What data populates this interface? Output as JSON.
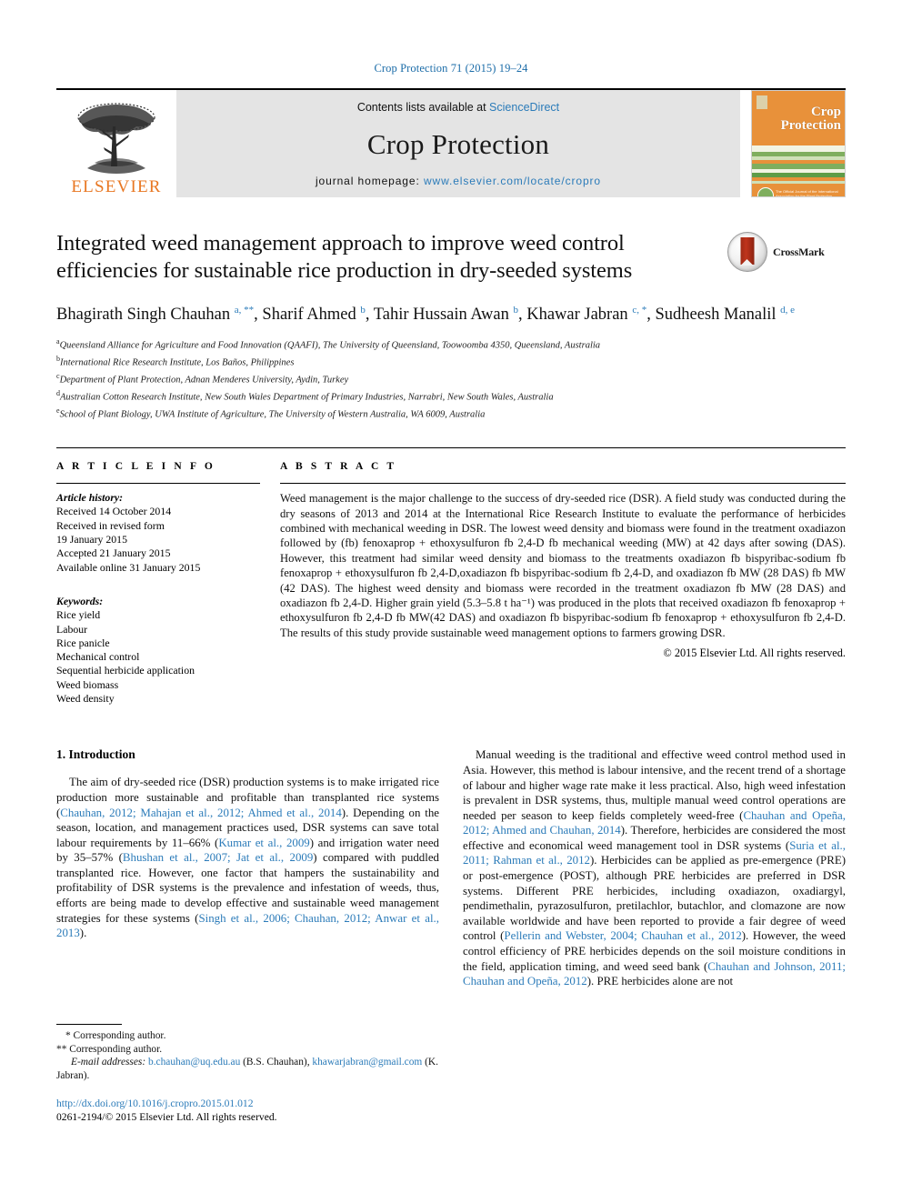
{
  "running_head": "Crop Protection 71 (2015) 19–24",
  "masthead": {
    "publisher_word": "ELSEVIER",
    "contents_prefix": "Contents lists available at ",
    "contents_link": "ScienceDirect",
    "journal_name": "Crop Protection",
    "homepage_prefix": "journal homepage: ",
    "homepage_url": "www.elsevier.com/locate/cropro",
    "cover_title_line1": "Crop",
    "cover_title_line2": "Protection",
    "cover_footer_text": "The Official Journal of the International Association for the Plant Protection Sciences"
  },
  "article": {
    "title": "Integrated weed management approach to improve weed control efficiencies for sustainable rice production in dry-seeded systems",
    "crossmark_label": "CrossMark",
    "authors_html": "Bhagirath Singh Chauhan <sup>a, **</sup>, Sharif Ahmed <sup>b</sup>, Tahir Hussain Awan <sup>b</sup>, Khawar Jabran <sup>c, *</sup>, Sudheesh Manalil <sup>d, e</sup>",
    "affiliations": [
      {
        "label": "a",
        "text": "Queensland Alliance for Agriculture and Food Innovation (QAAFI), The University of Queensland, Toowoomba 4350, Queensland, Australia"
      },
      {
        "label": "b",
        "text": "International Rice Research Institute, Los Baños, Philippines"
      },
      {
        "label": "c",
        "text": "Department of Plant Protection, Adnan Menderes University, Aydin, Turkey"
      },
      {
        "label": "d",
        "text": "Australian Cotton Research Institute, New South Wales Department of Primary Industries, Narrabri, New South Wales, Australia"
      },
      {
        "label": "e",
        "text": "School of Plant Biology, UWA Institute of Agriculture, The University of Western Australia, WA 6009, Australia"
      }
    ]
  },
  "article_info": {
    "heading": "A R T I C L E   I N F O",
    "history_label": "Article history:",
    "history_lines": [
      "Received 14 October 2014",
      "Received in revised form",
      "19 January 2015",
      "Accepted 21 January 2015",
      "Available online 31 January 2015"
    ],
    "keywords_label": "Keywords:",
    "keywords": [
      "Rice yield",
      "Labour",
      "Rice panicle",
      "Mechanical control",
      "Sequential herbicide application",
      "Weed biomass",
      "Weed density"
    ]
  },
  "abstract": {
    "heading": "A B S T R A C T",
    "text": "Weed management is the major challenge to the success of dry-seeded rice (DSR). A field study was conducted during the dry seasons of 2013 and 2014 at the International Rice Research Institute to evaluate the performance of herbicides combined with mechanical weeding in DSR. The lowest weed density and biomass were found in the treatment oxadiazon followed by (fb) fenoxaprop + ethoxysulfuron fb 2,4-D fb mechanical weeding (MW) at 42 days after sowing (DAS). However, this treatment had similar weed density and biomass to the treatments oxadiazon fb bispyribac-sodium fb fenoxaprop + ethoxysulfuron fb 2,4-D,oxadiazon fb bispyribac-sodium fb 2,4-D, and oxadiazon fb MW (28 DAS) fb MW (42 DAS). The highest weed density and biomass were recorded in the treatment oxadiazon fb MW (28 DAS) and oxadiazon fb 2,4-D. Higher grain yield (5.3–5.8 t ha⁻¹) was produced in the plots that received oxadiazon fb fenoxaprop + ethoxysulfuron fb 2,4-D fb MW(42 DAS) and oxadiazon fb bispyribac-sodium fb fenoxaprop + ethoxysulfuron fb 2,4-D. The results of this study provide sustainable weed management options to farmers growing DSR.",
    "copyright": "© 2015 Elsevier Ltd. All rights reserved."
  },
  "introduction": {
    "heading": "1. Introduction",
    "left_paragraph_html": "The aim of dry-seeded rice (DSR) production systems is to make irrigated rice production more sustainable and profitable than transplanted rice systems (<span class=\"ref\">Chauhan, 2012; Mahajan et al., 2012; Ahmed et al., 2014</span>). Depending on the season, location, and management practices used, DSR systems can save total labour requirements by 11–66% (<span class=\"ref\">Kumar et al., 2009</span>) and irrigation water need by 35–57% (<span class=\"ref\">Bhushan et al., 2007; Jat et al., 2009</span>) compared with puddled transplanted rice. However, one factor that hampers the sustainability and profitability of DSR systems is the prevalence and infestation of weeds, thus, efforts are being made to develop effective and sustainable weed management strategies for these systems (<span class=\"ref\">Singh et al., 2006; Chauhan, 2012; Anwar et al., 2013</span>).",
    "right_paragraph_html": "Manual weeding is the traditional and effective weed control method used in Asia. However, this method is labour intensive, and the recent trend of a shortage of labour and higher wage rate make it less practical. Also, high weed infestation is prevalent in DSR systems, thus, multiple manual weed control operations are needed per season to keep fields completely weed-free (<span class=\"ref\">Chauhan and Opeña, 2012; Ahmed and Chauhan, 2014</span>). Therefore, herbicides are considered the most effective and economical weed management tool in DSR systems (<span class=\"ref\">Suria et al., 2011; Rahman et al., 2012</span>). Herbicides can be applied as pre-emergence (PRE) or post-emergence (POST), although PRE herbicides are preferred in DSR systems. Different PRE herbicides, including oxadiazon, oxadiargyl, pendimethalin, pyrazosulfuron, pretilachlor, butachlor, and clomazone are now available worldwide and have been reported to provide a fair degree of weed control (<span class=\"ref\">Pellerin and Webster, 2004; Chauhan et al., 2012</span>). However, the weed control efficiency of PRE herbicides depends on the soil moisture conditions in the field, application timing, and weed seed bank (<span class=\"ref\">Chauhan and Johnson, 2011; Chauhan and Opeña, 2012</span>). PRE herbicides alone are not"
  },
  "footnotes": {
    "star_line": "* Corresponding author.",
    "doublestar_line": "** Corresponding author.",
    "email_label": "E-mail addresses:",
    "email_1": "b.chauhan@uq.edu.au",
    "email_1_owner": "(B.S. Chauhan),",
    "email_2": "khawarjabran@gmail.com",
    "email_2_owner": "(K. Jabran).",
    "doi": "http://dx.doi.org/10.1016/j.cropro.2015.01.012",
    "issn_line": "0261-2194/© 2015 Elsevier Ltd. All rights reserved."
  },
  "colors": {
    "link": "#2b7bb9",
    "elsevier_orange": "#e87722",
    "cover_orange": "#e8913a",
    "masthead_gray": "#e4e4e4"
  },
  "cover_stripes": [
    {
      "color": "#f2f4e4",
      "height": 7
    },
    {
      "color": "#7fae5e",
      "height": 5
    },
    {
      "color": "#cfe0b8",
      "height": 4
    },
    {
      "color": "#e8913a",
      "height": 4
    },
    {
      "color": "#7fae5e",
      "height": 6
    },
    {
      "color": "#f2f4e4",
      "height": 4
    },
    {
      "color": "#5f9c48",
      "height": 5
    },
    {
      "color": "#e8913a",
      "height": 4
    },
    {
      "color": "#cfe0b8",
      "height": 5
    },
    {
      "color": "#7fae5e",
      "height": 5
    },
    {
      "color": "#f2f4e4",
      "height": 6
    }
  ]
}
